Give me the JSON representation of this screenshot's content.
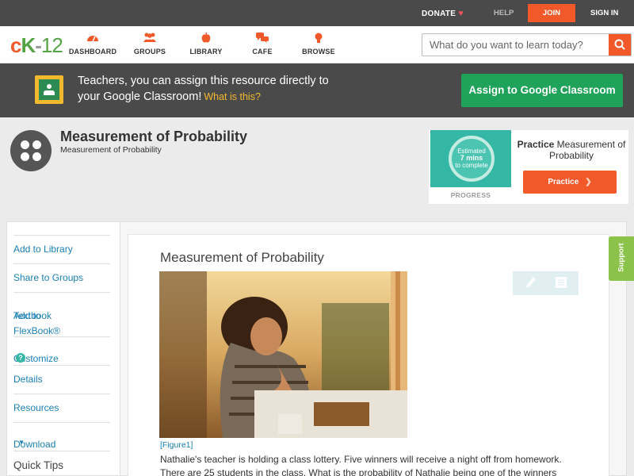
{
  "topbar": {
    "donate_label": "DONATE",
    "help_label": "HELP",
    "join_label": "JOIN",
    "signin_label": "SIGN IN"
  },
  "logo": {
    "text_c": "c",
    "text_k": "K",
    "text_dash": "-",
    "text_num": "12"
  },
  "nav": {
    "items": [
      {
        "label": "DASHBOARD",
        "icon": "gauge-icon"
      },
      {
        "label": "GROUPS",
        "icon": "people-icon"
      },
      {
        "label": "LIBRARY",
        "icon": "apple-icon"
      },
      {
        "label": "CAFE",
        "icon": "chat-icon"
      },
      {
        "label": "BROWSE",
        "icon": "bulb-icon"
      }
    ]
  },
  "search": {
    "placeholder": "What do you want to learn today?"
  },
  "banner": {
    "line1": "Teachers, you can assign this resource directly to",
    "line2": "your Google Classroom!",
    "what_link": "What is this?",
    "assign_button": "Assign to Google Classroom"
  },
  "concept": {
    "title": "Measurement of Probability",
    "subtitle": "Measurement of Probability"
  },
  "practice": {
    "progress_line1": "Estimated",
    "progress_line2": "7 mins",
    "progress_line3": "to complete",
    "progress_label": "PROGRESS",
    "title_bold": "Practice",
    "title_rest": "Measurement of Probability",
    "button": "Practice"
  },
  "sidebar": {
    "items": [
      {
        "label": "Add to Library"
      },
      {
        "label": "Share to Groups"
      },
      {
        "label": "Add to FlexBook®"
      },
      {
        "label": "Textbook"
      },
      {
        "label": "Customize"
      },
      {
        "label": "Details"
      },
      {
        "label": "Resources"
      },
      {
        "label": "Download"
      }
    ],
    "quick_tips": "Quick Tips"
  },
  "article": {
    "title": "Measurement of Probability",
    "figure_caption": "[Figure1]",
    "body_line1": "Nathalie's teacher is holding a class lottery.  Five winners will receive a night off from homework.",
    "body_line2": " There are 25 students in the class.  What is the probability of Nathalie being one of the winners"
  },
  "support": {
    "label": "Support"
  },
  "colors": {
    "accent": "#f1592a",
    "green": "#1fa25a",
    "link": "#1a7fb3",
    "teal": "#35b7a5"
  }
}
